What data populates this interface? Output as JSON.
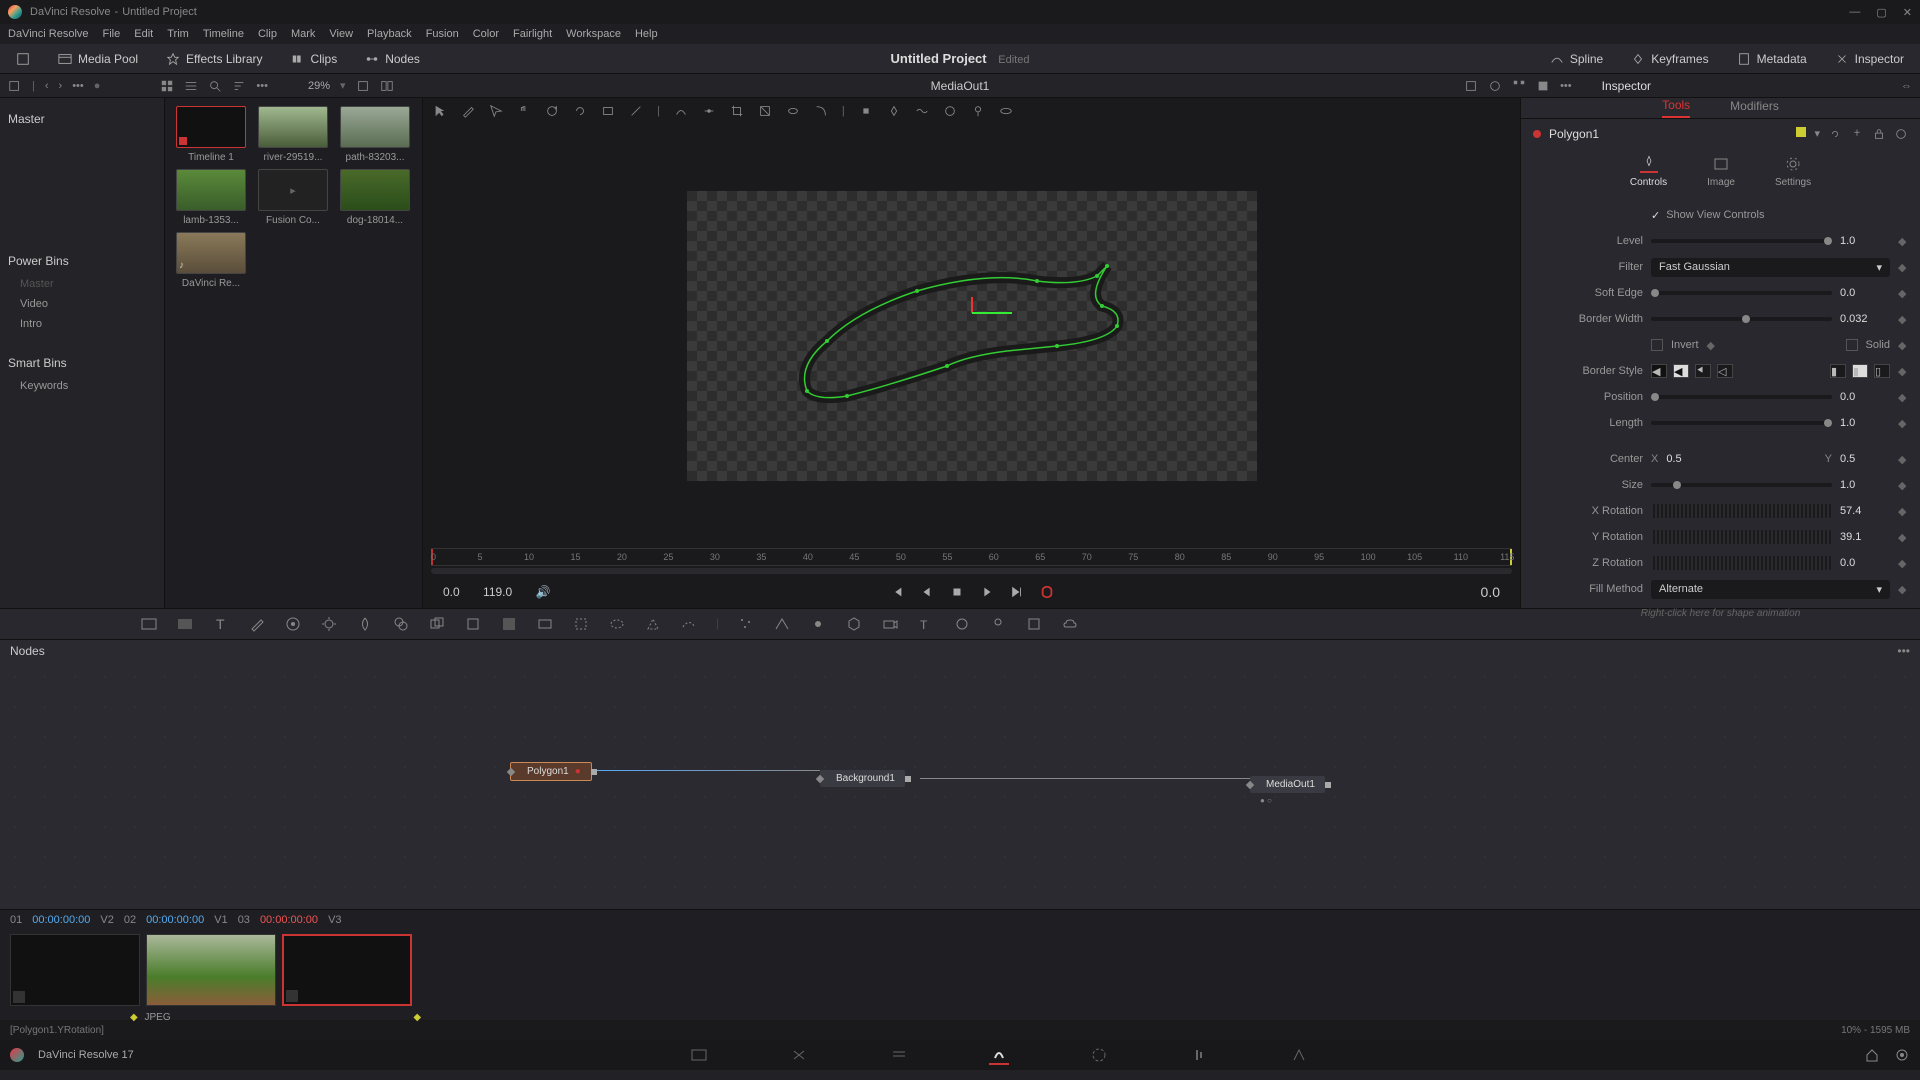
{
  "titlebar": {
    "app": "DaVinci Resolve",
    "project": "Untitled Project"
  },
  "menu": [
    "DaVinci Resolve",
    "File",
    "Edit",
    "Trim",
    "Timeline",
    "Clip",
    "Mark",
    "View",
    "Playback",
    "Fusion",
    "Color",
    "Fairlight",
    "Workspace",
    "Help"
  ],
  "toolbar": {
    "media_pool": "Media Pool",
    "effects": "Effects Library",
    "clips": "Clips",
    "nodes": "Nodes",
    "spline": "Spline",
    "keyframes": "Keyframes",
    "metadata": "Metadata",
    "inspector": "Inspector",
    "project": "Untitled Project",
    "edited": "Edited"
  },
  "secbar": {
    "zoom": "29%",
    "mediaout": "MediaOut1",
    "inspector": "Inspector"
  },
  "leftpanel": {
    "master": "Master",
    "powerbins": "Power Bins",
    "pb_master": "Master",
    "pb_video": "Video",
    "pb_intro": "Intro",
    "smartbins": "Smart Bins",
    "keywords": "Keywords"
  },
  "media": [
    {
      "label": "Timeline 1",
      "cls": "sel"
    },
    {
      "label": "river-29519...",
      "cls": "river"
    },
    {
      "label": "path-83203...",
      "cls": "path"
    },
    {
      "label": "lamb-1353...",
      "cls": "lamb"
    },
    {
      "label": "Fusion Co...",
      "cls": ""
    },
    {
      "label": "dog-18014...",
      "cls": "dog"
    },
    {
      "label": "DaVinci Re...",
      "cls": "audio"
    }
  ],
  "ruler_ticks": [
    "0",
    "5",
    "10",
    "15",
    "20",
    "25",
    "30",
    "35",
    "40",
    "45",
    "50",
    "55",
    "60",
    "65",
    "70",
    "75",
    "80",
    "85",
    "90",
    "95",
    "100",
    "105",
    "110",
    "115"
  ],
  "playbar": {
    "time": "0.0",
    "dur": "119.0",
    "right": "0.0"
  },
  "inspector_panel": {
    "tabs": {
      "tools": "Tools",
      "modifiers": "Modifiers"
    },
    "node_name": "Polygon1",
    "subtabs": {
      "controls": "Controls",
      "image": "Image",
      "settings": "Settings"
    },
    "show_view": "Show View Controls",
    "level": {
      "label": "Level",
      "val": "1.0"
    },
    "filter": {
      "label": "Filter",
      "val": "Fast Gaussian"
    },
    "soft_edge": {
      "label": "Soft Edge",
      "val": "0.0"
    },
    "border_width": {
      "label": "Border Width",
      "val": "0.032"
    },
    "invert": "Invert",
    "solid": "Solid",
    "border_style": "Border Style",
    "position": {
      "label": "Position",
      "val": "0.0"
    },
    "length": {
      "label": "Length",
      "val": "1.0"
    },
    "center": {
      "label": "Center",
      "x": "X",
      "xval": "0.5",
      "y": "Y",
      "yval": "0.5"
    },
    "size": {
      "label": "Size",
      "val": "1.0"
    },
    "xrot": {
      "label": "X Rotation",
      "val": "57.4"
    },
    "yrot": {
      "label": "Y Rotation",
      "val": "39.1"
    },
    "zrot": {
      "label": "Z Rotation",
      "val": "0.0"
    },
    "fill": {
      "label": "Fill Method",
      "val": "Alternate"
    },
    "hint": "Right-click here for shape animation"
  },
  "nodes": {
    "header": "Nodes",
    "polygon": "Polygon1",
    "background": "Background1",
    "mediaout": "MediaOut1"
  },
  "clips": {
    "c1": {
      "num": "01",
      "tc": "00:00:00:00",
      "track": "V2"
    },
    "c2": {
      "num": "02",
      "tc": "00:00:00:00",
      "track": "V1"
    },
    "c3": {
      "num": "03",
      "tc": "00:00:00:00",
      "track": "V3"
    },
    "format": "JPEG"
  },
  "status": {
    "left": "[Polygon1.YRotation]",
    "right": "10% - 1595 MB"
  },
  "bottomnav": {
    "app": "DaVinci Resolve 17"
  }
}
